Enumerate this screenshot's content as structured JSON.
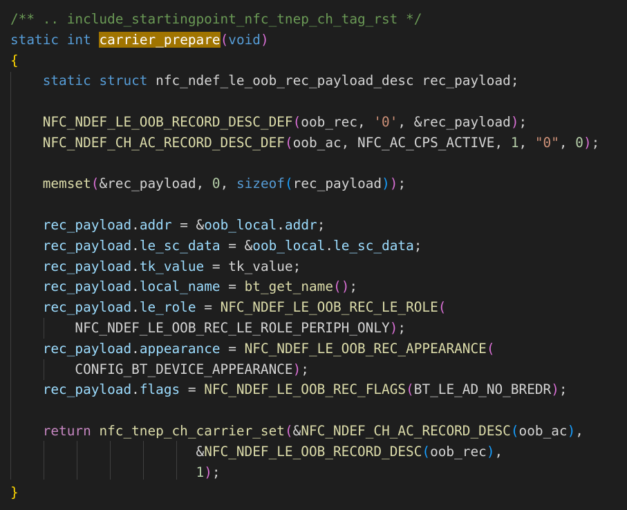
{
  "colors": {
    "background": "#1e1e1e",
    "comment": "#6a9955",
    "keyword": "#569cd6",
    "control": "#c586c0",
    "function": "#dcdcaa",
    "variable": "#9cdcfe",
    "string": "#ce9178",
    "number": "#b5cea8",
    "bracket_level1": "#ffd700",
    "bracket_level2": "#da70d6",
    "bracket_level3": "#179fff",
    "selection_highlight": "#a07400"
  },
  "code_lines": [
    [
      [
        "comment",
        "/** .. include_startingpoint_nfc_tnep_ch_tag_rst */"
      ]
    ],
    [
      [
        "keyword",
        "static"
      ],
      [
        "plain",
        " "
      ],
      [
        "keyword",
        "int"
      ],
      [
        "plain",
        " "
      ],
      [
        "highlight",
        "carrier_prepare"
      ],
      [
        "bracket2",
        "("
      ],
      [
        "keyword",
        "void"
      ],
      [
        "bracket2",
        ")"
      ]
    ],
    [
      [
        "bracket1",
        "{"
      ]
    ],
    [
      [
        "plain",
        "    "
      ],
      [
        "keyword",
        "static"
      ],
      [
        "plain",
        " "
      ],
      [
        "keyword",
        "struct"
      ],
      [
        "plain",
        " nfc_ndef_le_oob_rec_payload_desc rec_payload;"
      ]
    ],
    [],
    [
      [
        "plain",
        "    "
      ],
      [
        "macro",
        "NFC_NDEF_LE_OOB_RECORD_DESC_DEF"
      ],
      [
        "bracket2",
        "("
      ],
      [
        "plain",
        "oob_rec, "
      ],
      [
        "string",
        "'0'"
      ],
      [
        "plain",
        ", &rec_payload"
      ],
      [
        "bracket2",
        ")"
      ],
      [
        "plain",
        ";"
      ]
    ],
    [
      [
        "plain",
        "    "
      ],
      [
        "macro",
        "NFC_NDEF_CH_AC_RECORD_DESC_DEF"
      ],
      [
        "bracket2",
        "("
      ],
      [
        "plain",
        "oob_ac, NFC_AC_CPS_ACTIVE, "
      ],
      [
        "number",
        "1"
      ],
      [
        "plain",
        ", "
      ],
      [
        "string",
        "\"0\""
      ],
      [
        "plain",
        ", "
      ],
      [
        "number",
        "0"
      ],
      [
        "bracket2",
        ")"
      ],
      [
        "plain",
        ";"
      ]
    ],
    [],
    [
      [
        "plain",
        "    "
      ],
      [
        "function",
        "memset"
      ],
      [
        "bracket2",
        "("
      ],
      [
        "plain",
        "&rec_payload, "
      ],
      [
        "number",
        "0"
      ],
      [
        "plain",
        ", "
      ],
      [
        "keyword",
        "sizeof"
      ],
      [
        "bracket3",
        "("
      ],
      [
        "plain",
        "rec_payload"
      ],
      [
        "bracket3",
        ")"
      ],
      [
        "bracket2",
        ")"
      ],
      [
        "plain",
        ";"
      ]
    ],
    [],
    [
      [
        "plain",
        "    "
      ],
      [
        "variable",
        "rec_payload"
      ],
      [
        "plain",
        "."
      ],
      [
        "variable",
        "addr"
      ],
      [
        "plain",
        " = &"
      ],
      [
        "variable",
        "oob_local"
      ],
      [
        "plain",
        "."
      ],
      [
        "variable",
        "addr"
      ],
      [
        "plain",
        ";"
      ]
    ],
    [
      [
        "plain",
        "    "
      ],
      [
        "variable",
        "rec_payload"
      ],
      [
        "plain",
        "."
      ],
      [
        "variable",
        "le_sc_data"
      ],
      [
        "plain",
        " = &"
      ],
      [
        "variable",
        "oob_local"
      ],
      [
        "plain",
        "."
      ],
      [
        "variable",
        "le_sc_data"
      ],
      [
        "plain",
        ";"
      ]
    ],
    [
      [
        "plain",
        "    "
      ],
      [
        "variable",
        "rec_payload"
      ],
      [
        "plain",
        "."
      ],
      [
        "variable",
        "tk_value"
      ],
      [
        "plain",
        " = tk_value;"
      ]
    ],
    [
      [
        "plain",
        "    "
      ],
      [
        "variable",
        "rec_payload"
      ],
      [
        "plain",
        "."
      ],
      [
        "variable",
        "local_name"
      ],
      [
        "plain",
        " = "
      ],
      [
        "function",
        "bt_get_name"
      ],
      [
        "bracket2",
        "()"
      ],
      [
        "plain",
        ";"
      ]
    ],
    [
      [
        "plain",
        "    "
      ],
      [
        "variable",
        "rec_payload"
      ],
      [
        "plain",
        "."
      ],
      [
        "variable",
        "le_role"
      ],
      [
        "plain",
        " = "
      ],
      [
        "macro",
        "NFC_NDEF_LE_OOB_REC_LE_ROLE"
      ],
      [
        "bracket2",
        "("
      ]
    ],
    [
      [
        "plain",
        "        NFC_NDEF_LE_OOB_REC_LE_ROLE_PERIPH_ONLY"
      ],
      [
        "bracket2",
        ")"
      ],
      [
        "plain",
        ";"
      ]
    ],
    [
      [
        "plain",
        "    "
      ],
      [
        "variable",
        "rec_payload"
      ],
      [
        "plain",
        "."
      ],
      [
        "variable",
        "appearance"
      ],
      [
        "plain",
        " = "
      ],
      [
        "macro",
        "NFC_NDEF_LE_OOB_REC_APPEARANCE"
      ],
      [
        "bracket2",
        "("
      ]
    ],
    [
      [
        "plain",
        "        CONFIG_BT_DEVICE_APPEARANCE"
      ],
      [
        "bracket2",
        ")"
      ],
      [
        "plain",
        ";"
      ]
    ],
    [
      [
        "plain",
        "    "
      ],
      [
        "variable",
        "rec_payload"
      ],
      [
        "plain",
        "."
      ],
      [
        "variable",
        "flags"
      ],
      [
        "plain",
        " = "
      ],
      [
        "macro",
        "NFC_NDEF_LE_OOB_REC_FLAGS"
      ],
      [
        "bracket2",
        "("
      ],
      [
        "plain",
        "BT_LE_AD_NO_BREDR"
      ],
      [
        "bracket2",
        ")"
      ],
      [
        "plain",
        ";"
      ]
    ],
    [],
    [
      [
        "plain",
        "    "
      ],
      [
        "control",
        "return"
      ],
      [
        "plain",
        " "
      ],
      [
        "function",
        "nfc_tnep_ch_carrier_set"
      ],
      [
        "bracket2",
        "("
      ],
      [
        "plain",
        "&"
      ],
      [
        "macro",
        "NFC_NDEF_CH_AC_RECORD_DESC"
      ],
      [
        "bracket3",
        "("
      ],
      [
        "plain",
        "oob_ac"
      ],
      [
        "bracket3",
        ")"
      ],
      [
        "plain",
        ","
      ]
    ],
    [
      [
        "plain",
        "                       &"
      ],
      [
        "macro",
        "NFC_NDEF_LE_OOB_RECORD_DESC"
      ],
      [
        "bracket3",
        "("
      ],
      [
        "plain",
        "oob_rec"
      ],
      [
        "bracket3",
        ")"
      ],
      [
        "plain",
        ","
      ]
    ],
    [
      [
        "plain",
        "                       "
      ],
      [
        "number",
        "1"
      ],
      [
        "bracket2",
        ")"
      ],
      [
        "plain",
        ";"
      ]
    ],
    [
      [
        "bracket1",
        "}"
      ]
    ]
  ]
}
